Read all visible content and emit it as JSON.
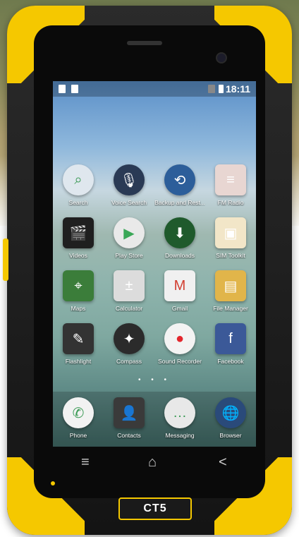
{
  "status_bar": {
    "time": "18:11"
  },
  "apps": [
    {
      "label": "Search",
      "icon": "search-icon",
      "color": "#dfe7ee",
      "glyph": "⌕"
    },
    {
      "label": "Voice Search",
      "icon": "microphone-icon",
      "color": "#2a3a55",
      "glyph": "🎙"
    },
    {
      "label": "Backup and Rest...",
      "icon": "backup-restore-icon",
      "color": "#2c5e9a",
      "glyph": "⟲"
    },
    {
      "label": "FM Radio",
      "icon": "radio-icon",
      "color": "#e8d6d2",
      "glyph": "≡"
    },
    {
      "label": "Videos",
      "icon": "clapperboard-icon",
      "color": "#1f1f1f",
      "glyph": "🎬"
    },
    {
      "label": "Play Store",
      "icon": "play-store-icon",
      "color": "#e9e9e9",
      "glyph": "▶"
    },
    {
      "label": "Downloads",
      "icon": "download-icon",
      "color": "#1f5a2c",
      "glyph": "⬇"
    },
    {
      "label": "SIM Toolkit",
      "icon": "sim-card-icon",
      "color": "#f2e6c8",
      "glyph": "▣"
    },
    {
      "label": "Maps",
      "icon": "maps-icon",
      "color": "#3b7d3a",
      "glyph": "⌖"
    },
    {
      "label": "Calculator",
      "icon": "calculator-icon",
      "color": "#dcdcdc",
      "glyph": "±"
    },
    {
      "label": "Gmail",
      "icon": "gmail-icon",
      "color": "#f0f0f0",
      "glyph": "M"
    },
    {
      "label": "File Manager",
      "icon": "folder-icon",
      "color": "#e1b54a",
      "glyph": "▤"
    },
    {
      "label": "Flashlight",
      "icon": "flashlight-icon",
      "color": "#333333",
      "glyph": "✎"
    },
    {
      "label": "Compass",
      "icon": "compass-icon",
      "color": "#2b2b2b",
      "glyph": "✦"
    },
    {
      "label": "Sound Recorder",
      "icon": "record-icon",
      "color": "#f3f3f3",
      "glyph": "●"
    },
    {
      "label": "Facebook",
      "icon": "facebook-icon",
      "color": "#3b5998",
      "glyph": "f"
    }
  ],
  "page_indicator": "• • •",
  "dock": [
    {
      "label": "Phone",
      "icon": "phone-icon",
      "color": "#f2f2f2",
      "glyph": "✆"
    },
    {
      "label": "Contacts",
      "icon": "contacts-icon",
      "color": "#3a3a3a",
      "glyph": "👤"
    },
    {
      "label": "Messaging",
      "icon": "messaging-icon",
      "color": "#e8e8e8",
      "glyph": "…"
    },
    {
      "label": "Browser",
      "icon": "globe-icon",
      "color": "#2a4a7a",
      "glyph": "🌐"
    }
  ],
  "nav": {
    "menu": "≡",
    "home": "⌂",
    "back": "<"
  },
  "model_label": "CT5"
}
